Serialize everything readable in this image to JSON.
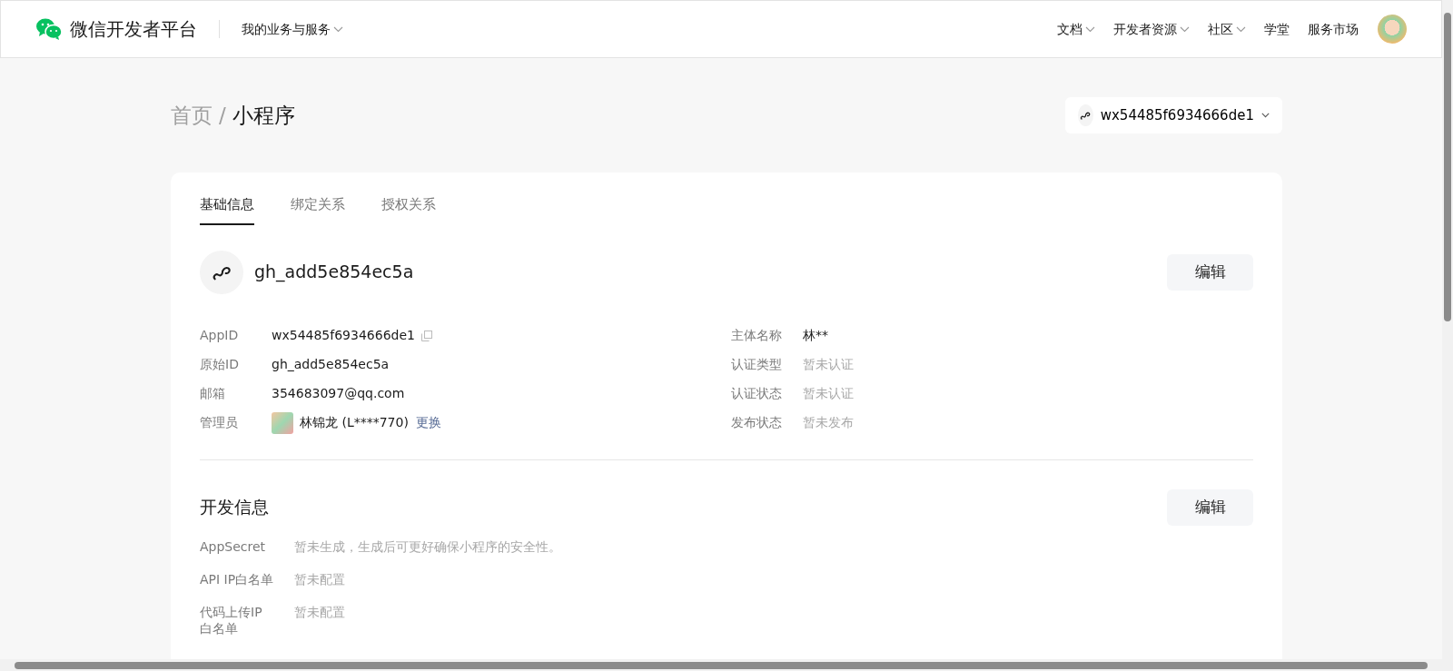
{
  "header": {
    "brand": "微信开发者平台",
    "business_menu": "我的业务与服务",
    "nav": [
      {
        "label": "文档",
        "has_menu": true
      },
      {
        "label": "开发者资源",
        "has_menu": true
      },
      {
        "label": "社区",
        "has_menu": true
      },
      {
        "label": "学堂",
        "has_menu": false
      },
      {
        "label": "服务市场",
        "has_menu": false
      }
    ]
  },
  "breadcrumb": {
    "separator": "/",
    "items": [
      {
        "label": "首页",
        "current": false
      },
      {
        "label": "小程序",
        "current": true
      }
    ]
  },
  "app_selector": {
    "value": "wx54485f6934666de1"
  },
  "tabs": [
    {
      "label": "基础信息",
      "selected": true
    },
    {
      "label": "绑定关系",
      "selected": false
    },
    {
      "label": "授权关系",
      "selected": false
    }
  ],
  "basic_info": {
    "name": "gh_add5e854ec5a",
    "edit_button": "编辑",
    "left_fields": [
      {
        "label": "AppID",
        "value": "wx54485f6934666de1",
        "kind": "copy",
        "muted": false
      },
      {
        "label": "原始ID",
        "value": "gh_add5e854ec5a",
        "kind": "text",
        "muted": false
      },
      {
        "label": "邮箱",
        "value": "354683097@qq.com",
        "kind": "text",
        "muted": false
      },
      {
        "label": "管理员",
        "value": "林锦龙 (L****770)",
        "kind": "admin",
        "action": "更换",
        "muted": false
      }
    ],
    "right_fields": [
      {
        "label": "主体名称",
        "value": "林**",
        "muted": false
      },
      {
        "label": "认证类型",
        "value": "暂未认证",
        "muted": true
      },
      {
        "label": "认证状态",
        "value": "暂未认证",
        "muted": true
      },
      {
        "label": "发布状态",
        "value": "暂未发布",
        "muted": true
      }
    ]
  },
  "dev_info": {
    "title": "开发信息",
    "edit_button": "编辑",
    "fields": [
      {
        "label": "AppSecret",
        "value": "暂未生成，生成后可更好确保小程序的安全性。",
        "muted": true
      },
      {
        "label": "API IP白名单",
        "value": "暂未配置",
        "muted": true
      },
      {
        "label": "代码上传IP白名单",
        "value": "暂未配置",
        "muted": true
      }
    ]
  }
}
